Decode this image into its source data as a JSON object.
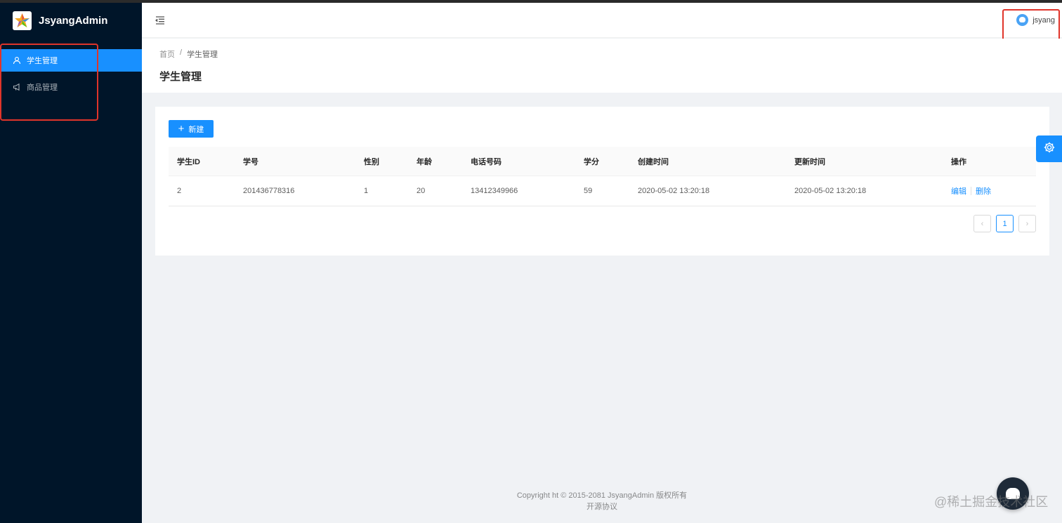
{
  "app": {
    "title": "JsyangAdmin"
  },
  "sidebar": {
    "items": [
      {
        "label": "学生管理",
        "icon": "user-icon",
        "active": true
      },
      {
        "label": "商品管理",
        "icon": "sound-icon",
        "active": false
      }
    ]
  },
  "header": {
    "username": "jsyang"
  },
  "breadcrumb": {
    "home": "首页",
    "separator": "/",
    "current": "学生管理"
  },
  "page": {
    "title": "学生管理"
  },
  "toolbar": {
    "new_label": "新建"
  },
  "table": {
    "columns": [
      "学生ID",
      "学号",
      "性别",
      "年龄",
      "电话号码",
      "学分",
      "创建时间",
      "更新时间",
      "操作"
    ],
    "rows": [
      {
        "id": "2",
        "no": "201436778316",
        "gender": "1",
        "age": "20",
        "phone": "13412349966",
        "credit": "59",
        "created": "2020-05-02 13:20:18",
        "updated": "2020-05-02 13:20:18"
      }
    ],
    "actions": {
      "edit": "编辑",
      "delete": "删除"
    }
  },
  "pagination": {
    "current": "1",
    "prev": "‹",
    "next": "›"
  },
  "footer": {
    "copyright": "Copyright ht © 2015-2081 JsyangAdmin 版权所有",
    "license": "开源协议"
  },
  "watermark": "@稀土掘金技术社区",
  "colors": {
    "primary": "#1890ff",
    "sider": "#001529",
    "highlight": "#e0342a"
  }
}
